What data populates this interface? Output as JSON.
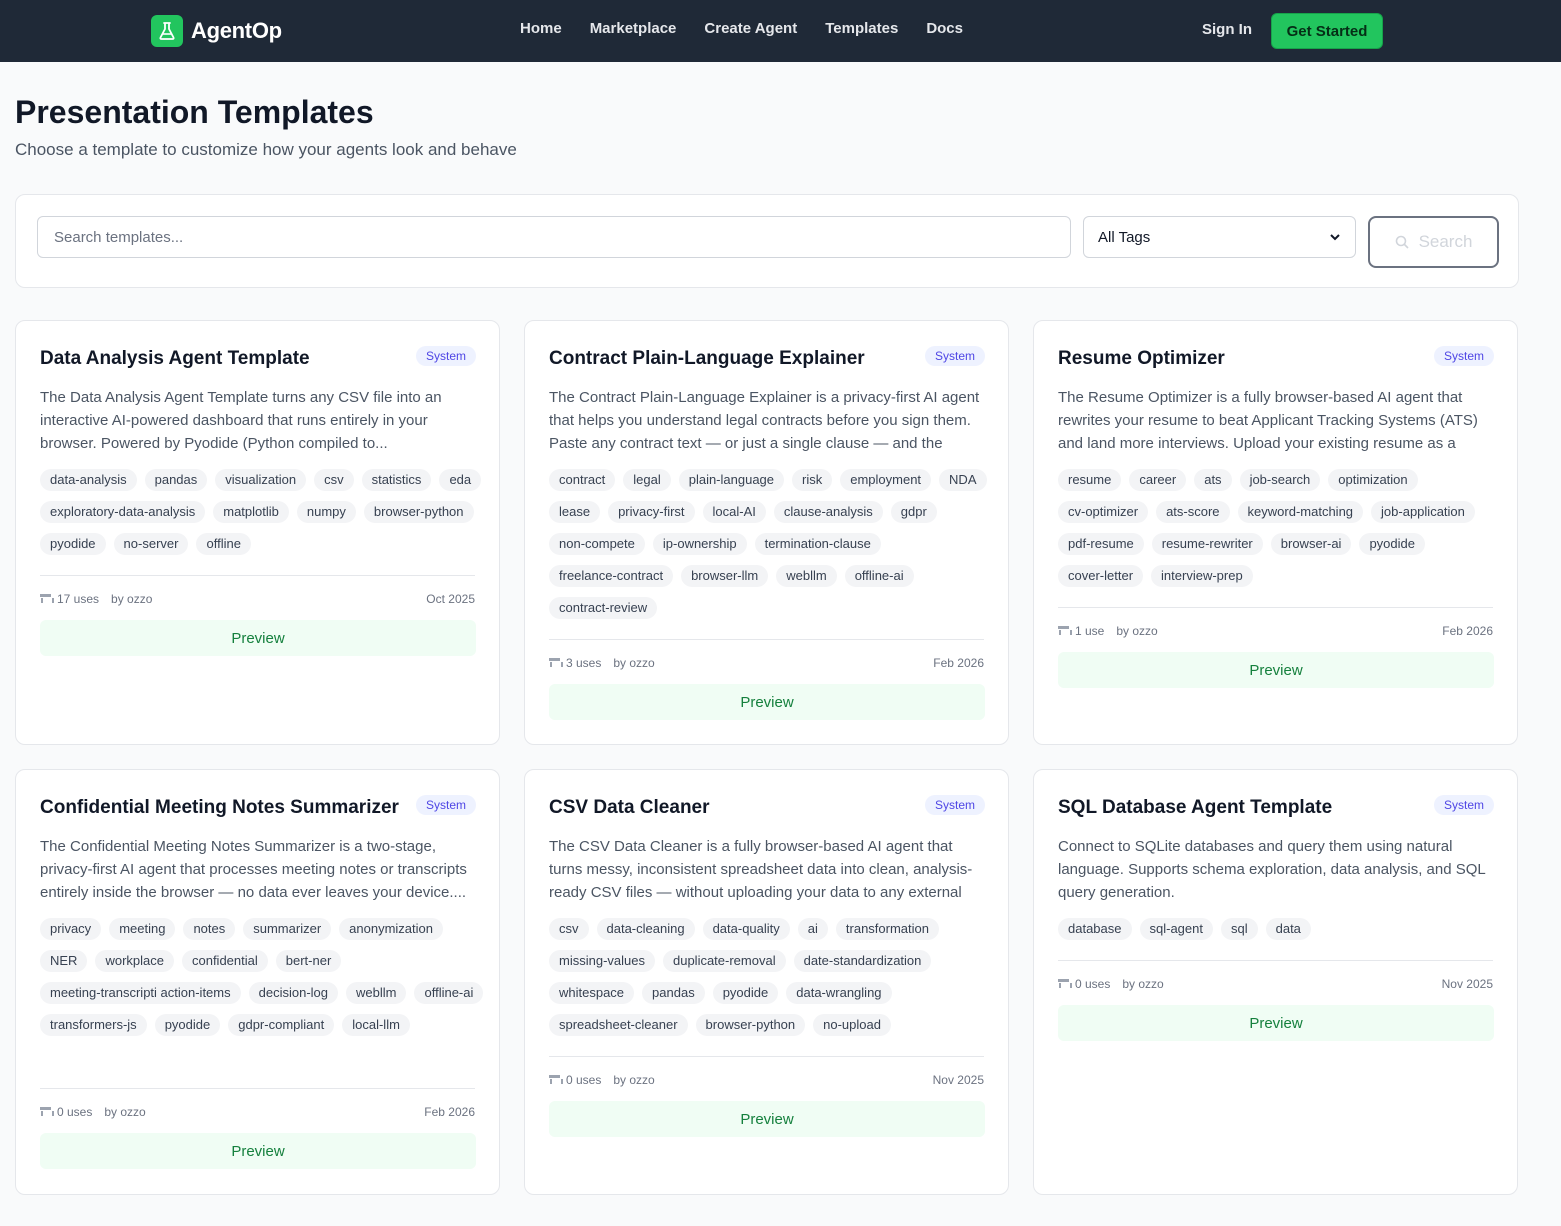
{
  "nav": {
    "brand": "AgentOp",
    "links": [
      "Home",
      "Marketplace",
      "Create Agent",
      "Templates",
      "Docs"
    ],
    "sign_in": "Sign In",
    "get_started": "Get Started"
  },
  "header": {
    "title": "Presentation Templates",
    "subtitle": "Choose a template to customize how your agents look and behave"
  },
  "search": {
    "placeholder": "Search templates...",
    "tag_filter": "All Tags",
    "button": "Search"
  },
  "cards": [
    {
      "title": "Data Analysis Agent Template",
      "badge": "System",
      "description": "The Data Analysis Agent Template turns any CSV file into an interactive AI-powered dashboard that runs entirely in your browser. Powered by Pyodide (Python compiled to...",
      "tags": [
        "data-analysis",
        "pandas",
        "visualization",
        "csv",
        "statistics",
        "eda",
        "exploratory-data-analysis",
        "matplotlib",
        "numpy",
        "browser-python",
        "pyodide",
        "no-server",
        "offline"
      ],
      "uses": "17 uses",
      "author": "by ozzo",
      "date": "Oct 2025",
      "preview": "Preview"
    },
    {
      "title": "Contract Plain-Language Explainer",
      "badge": "System",
      "description": "The Contract Plain-Language Explainer is a privacy-first AI agent that helps you understand legal contracts before you sign them. Paste any contract text — or just a single clause — and the agent...",
      "tags": [
        "contract",
        "legal",
        "plain-language",
        "risk",
        "employment",
        "NDA",
        "lease",
        "privacy-first",
        "local-AI",
        "clause-analysis",
        "gdpr",
        "non-compete",
        "ip-ownership",
        "termination-clause",
        "freelance-contract",
        "browser-llm",
        "webllm",
        "offline-ai",
        "contract-review"
      ],
      "uses": "3 uses",
      "author": "by ozzo",
      "date": "Feb 2026",
      "preview": "Preview"
    },
    {
      "title": "Resume Optimizer",
      "badge": "System",
      "description": "The Resume Optimizer is a fully browser-based AI agent that rewrites your resume to beat Applicant Tracking Systems (ATS) and land more interviews. Upload your existing resume as a PDF,...",
      "tags": [
        "resume",
        "career",
        "ats",
        "job-search",
        "optimization",
        "cv-optimizer",
        "ats-score",
        "keyword-matching",
        "job-application",
        "pdf-resume",
        "resume-rewriter",
        "browser-ai",
        "pyodide",
        "cover-letter",
        "interview-prep"
      ],
      "uses": "1 use",
      "author": "by ozzo",
      "date": "Feb 2026",
      "preview": "Preview"
    },
    {
      "title": "Confidential Meeting Notes Summarizer",
      "badge": "System",
      "description": "The Confidential Meeting Notes Summarizer is a two-stage, privacy-first AI agent that processes meeting notes or transcripts entirely inside the browser — no data ever leaves your device....",
      "tags": [
        "privacy",
        "meeting",
        "notes",
        "summarizer",
        "anonymization",
        "NER",
        "workplace",
        "confidential",
        "bert-ner",
        "meeting-transcripti action-items",
        "decision-log",
        "webllm",
        "offline-ai",
        "transformers-js",
        "pyodide",
        "gdpr-compliant",
        "local-llm"
      ],
      "uses": "0 uses",
      "author": "by ozzo",
      "date": "Feb 2026",
      "preview": "Preview"
    },
    {
      "title": "CSV Data Cleaner",
      "badge": "System",
      "description": "The CSV Data Cleaner is a fully browser-based AI agent that turns messy, inconsistent spreadsheet data into clean, analysis-ready CSV files — without uploading your data to any external server....",
      "tags": [
        "csv",
        "data-cleaning",
        "data-quality",
        "ai",
        "transformation",
        "missing-values",
        "duplicate-removal",
        "date-standardization",
        "whitespace",
        "pandas",
        "pyodide",
        "data-wrangling",
        "spreadsheet-cleaner",
        "browser-python",
        "no-upload"
      ],
      "uses": "0 uses",
      "author": "by ozzo",
      "date": "Nov 2025",
      "preview": "Preview"
    },
    {
      "title": "SQL Database Agent Template",
      "badge": "System",
      "description": "Connect to SQLite databases and query them using natural language. Supports schema exploration, data analysis, and SQL query generation.",
      "tags": [
        "database",
        "sql-agent",
        "sql",
        "data"
      ],
      "uses": "0 uses",
      "author": "by ozzo",
      "date": "Nov 2025",
      "preview": "Preview"
    }
  ]
}
